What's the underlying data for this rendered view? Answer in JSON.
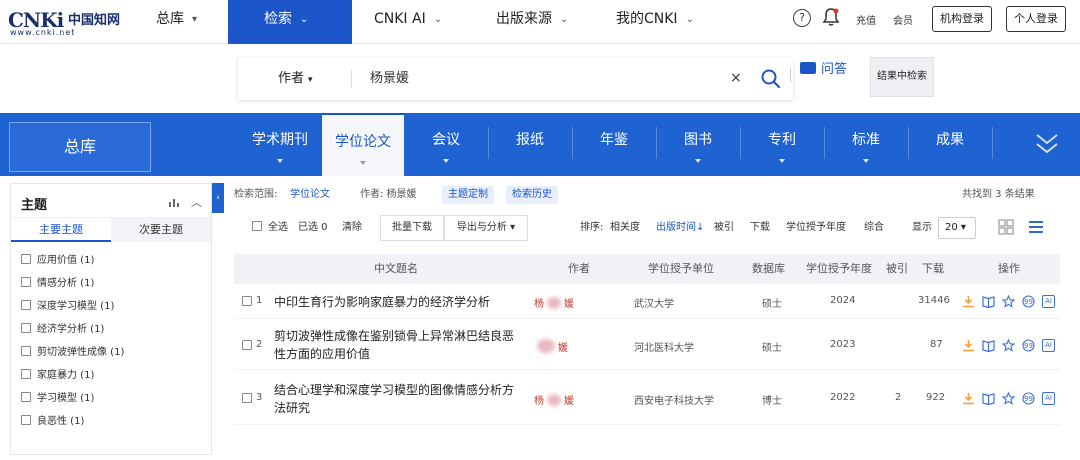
{
  "logo": {
    "mark": "CNKi",
    "cn": "中国知网",
    "url": "www.cnki.net"
  },
  "nav": {
    "items": [
      {
        "label": "总库",
        "active": false
      },
      {
        "label": "检索",
        "active": true
      },
      {
        "label": "CNKI AI",
        "active": false
      },
      {
        "label": "出版来源",
        "active": false
      },
      {
        "label": "我的CNKI",
        "active": false
      }
    ],
    "help_icon": "?",
    "recharge": "充值",
    "member": "会员",
    "org_login": "机构登录",
    "personal_login": "个人登录"
  },
  "search": {
    "field": "作者",
    "query": "杨景媛",
    "clear": "×",
    "qa_label": "问答",
    "in_result": "结果中检索"
  },
  "db_tabs": {
    "all": "总库",
    "tabs": [
      "学术期刊",
      "学位论文",
      "会议",
      "报纸",
      "年鉴",
      "图书",
      "专利",
      "标准",
      "成果"
    ],
    "active_index": 1
  },
  "left_panel": {
    "title": "主题",
    "tabs": [
      "主要主题",
      "次要主题"
    ],
    "items": [
      "应用价值 (1)",
      "情感分析 (1)",
      "深度学习模型 (1)",
      "经济学分析 (1)",
      "剪切波弹性成像 (1)",
      "家庭暴力 (1)",
      "学习模型 (1)",
      "良恶性 (1)"
    ]
  },
  "results": {
    "scope_label": "检索范围:",
    "scope_value": "学位论文",
    "author_filter": "作者: 杨景媛",
    "chip_custom": "主题定制",
    "chip_history": "检索历史",
    "found_text": "共找到 3 条结果",
    "select_all": "全选",
    "selected": "已选 0",
    "clear": "清除",
    "batch_download": "批量下载",
    "export_analysis": "导出与分析",
    "sort_label": "排序:",
    "sort_options": [
      "相关度",
      "出版时间",
      "被引",
      "下载",
      "学位授予年度",
      "综合"
    ],
    "sort_active": "出版时间",
    "show_label": "显示",
    "show_value": "20"
  },
  "table": {
    "headers": [
      "中文题名",
      "作者",
      "学位授予单位",
      "数据库",
      "学位授予年度",
      "被引",
      "下载",
      "操作"
    ],
    "rows": [
      {
        "index": "1",
        "title": "中印生育行为影响家庭暴力的经济学分析",
        "author_first": "杨",
        "author_last": "媛",
        "unit": "武汉大学",
        "db": "硕士",
        "year": "2024",
        "cited": "",
        "downloads": "31446"
      },
      {
        "index": "2",
        "title": "剪切波弹性成像在鉴别锁骨上异常淋巴结良恶性方面的应用价值",
        "author_first": "",
        "author_last": "媛",
        "unit": "河北医科大学",
        "db": "硕士",
        "year": "2023",
        "cited": "",
        "downloads": "87"
      },
      {
        "index": "3",
        "title": "结合心理学和深度学习模型的图像情感分析方法研究",
        "author_first": "杨",
        "author_last": "媛",
        "unit": "西安电子科技大学",
        "db": "博士",
        "year": "2022",
        "cited": "2",
        "downloads": "922"
      }
    ],
    "op_ai": "AI"
  },
  "colors": {
    "brand_blue": "#1b55c9",
    "db_bar": "#1f63d3",
    "download_orange": "#f0a23b"
  }
}
